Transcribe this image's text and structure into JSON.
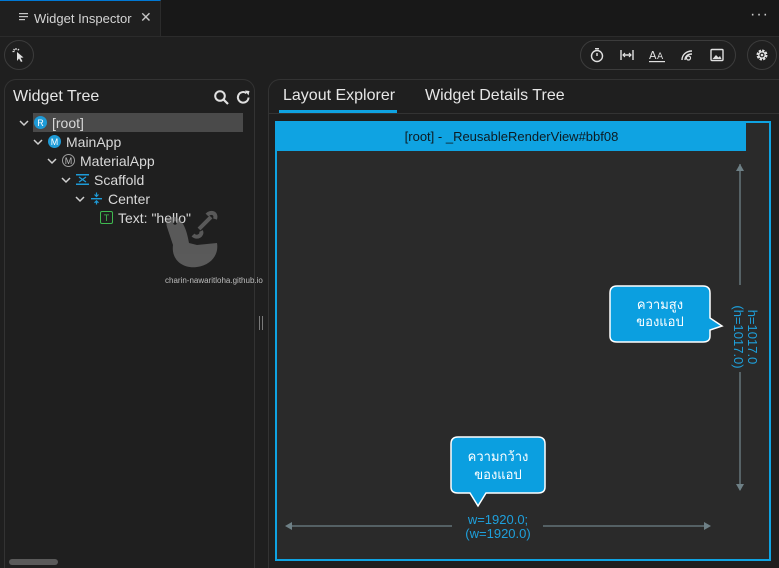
{
  "editor_tab": {
    "title": "Widget Inspector",
    "close": "✕",
    "more": "···"
  },
  "widget_tree": {
    "title": "Widget Tree",
    "items": [
      {
        "label": "[root]",
        "badge": "R",
        "badge_color": "#1e9bd7"
      },
      {
        "label": "MainApp",
        "badge": "M",
        "badge_color": "#1e9bd7"
      },
      {
        "label": "MaterialApp",
        "badge": "M",
        "badge_color": "#9e9e9e"
      },
      {
        "label": "Scaffold",
        "badge": "scaffold-icon",
        "badge_color": "#1e9bd7"
      },
      {
        "label": "Center",
        "badge": "center-icon",
        "badge_color": "#1e9bd7"
      },
      {
        "label": "Text: \"hello\"",
        "badge": "T",
        "badge_color": "#3fb950"
      }
    ]
  },
  "watermark": {
    "text": "charin-nawaritloha.github.io"
  },
  "details": {
    "tabs": [
      {
        "label": "Layout Explorer"
      },
      {
        "label": "Widget Details Tree"
      }
    ],
    "render_title": "[root] - _ReusableRenderView#bbf08",
    "height_label": "h=1017.0",
    "height_label2": "(h=1017.0)",
    "width_label": "w=1920.0;",
    "width_label2": "(w=1920.0)",
    "callout_height": [
      "ความสูง",
      "ของแอป"
    ],
    "callout_width": [
      "ความกว้าง",
      "ของแอป"
    ]
  },
  "colors": {
    "accent": "#0fa3e2",
    "callout": "#0b9fe0",
    "dim_line": "#6e8086"
  }
}
